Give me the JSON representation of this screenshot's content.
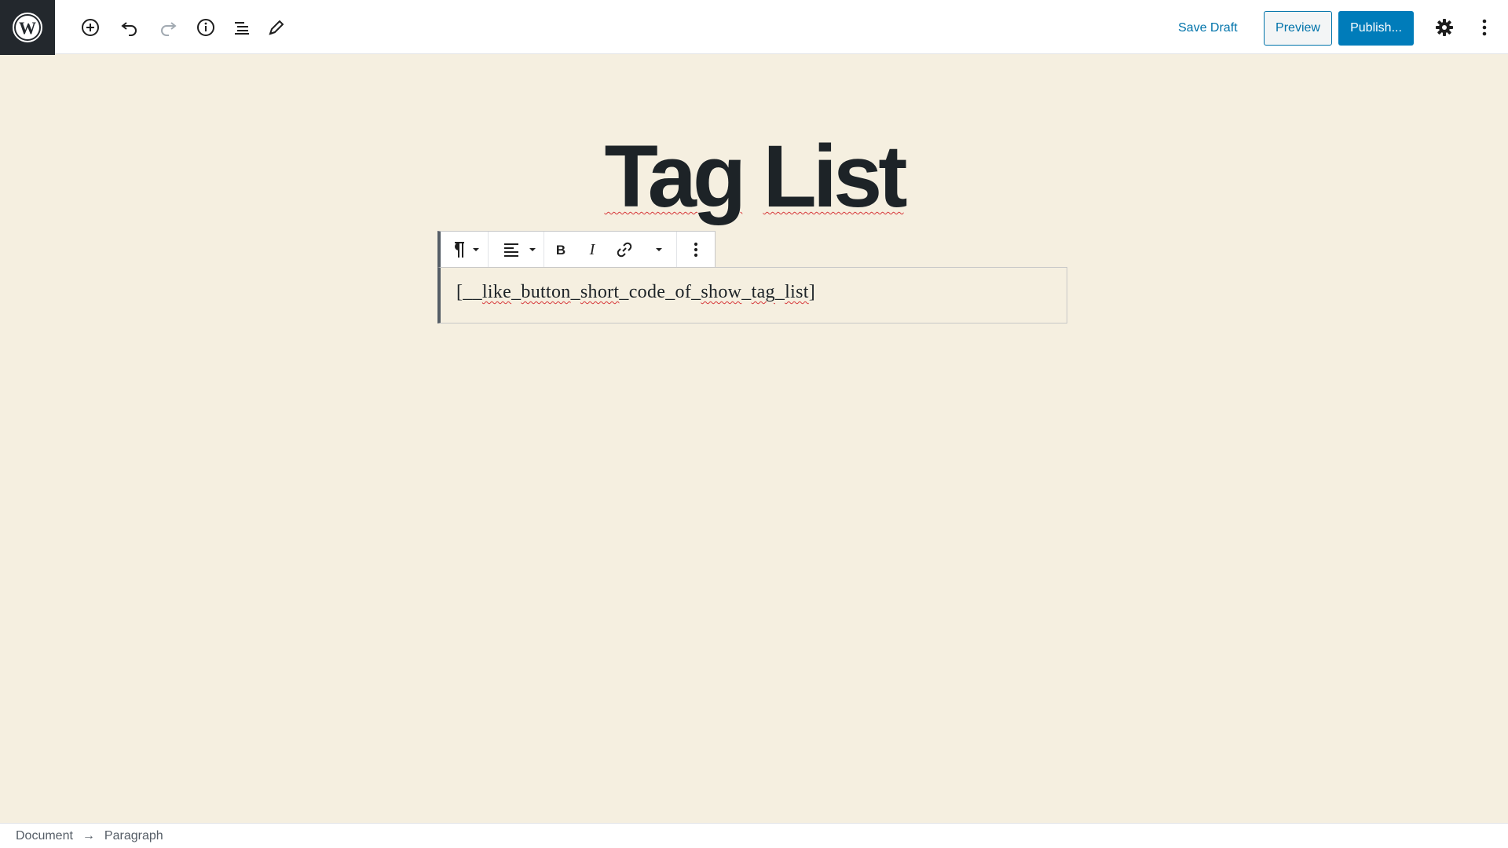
{
  "header": {
    "tools": [
      {
        "icon": "add-block-icon"
      },
      {
        "icon": "undo-icon"
      },
      {
        "icon": "redo-icon"
      },
      {
        "icon": "info-icon"
      },
      {
        "icon": "block-navigation-icon"
      },
      {
        "icon": "edit-mode-icon"
      }
    ],
    "save_draft_label": "Save Draft",
    "preview_label": "Preview",
    "publish_label": "Publish...",
    "accent_color": "#007cba"
  },
  "post": {
    "title_words": [
      "Tag",
      "List"
    ],
    "paragraph": {
      "open": "[",
      "u1": "__",
      "w_like": "like",
      "s1": "_",
      "w_button": "button",
      "s2": "_",
      "w_short": "short",
      "s3": "_",
      "w_code": "code",
      "s4": "_",
      "w_of": "of",
      "s5": "_",
      "w_show": "show",
      "s6": "_",
      "w_tag": "tag",
      "s7": "_",
      "w_list": "list",
      "close": "]"
    }
  },
  "block_toolbar": {
    "icons": [
      "paragraph-icon",
      "align-left-icon",
      "bold-icon",
      "italic-icon",
      "link-icon",
      "more-rich-text-icon",
      "more-options-icon"
    ]
  },
  "breadcrumb": {
    "items": [
      "Document",
      "Paragraph"
    ],
    "separator": "→"
  }
}
